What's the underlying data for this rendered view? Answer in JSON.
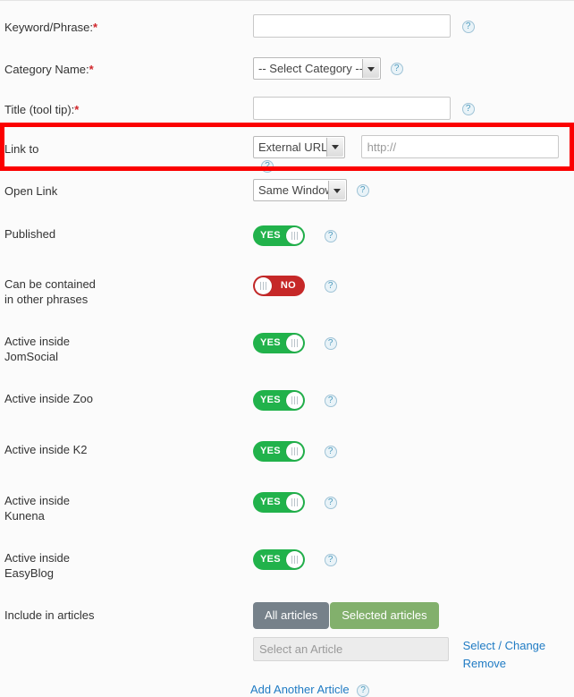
{
  "form": {
    "fields": [
      {
        "key": "keyword",
        "label": "Keyword/Phrase:",
        "required": true,
        "type": "text",
        "value": "",
        "placeholder": "",
        "help": "?"
      },
      {
        "key": "category",
        "label": "Category Name:",
        "required": true,
        "type": "select",
        "value": "-- Select Category --",
        "options": [
          "-- Select Category --"
        ],
        "help": "?"
      },
      {
        "key": "title",
        "label": "Title (tool tip):",
        "required": true,
        "type": "text",
        "value": "",
        "placeholder": "",
        "help": "?"
      },
      {
        "key": "link_to",
        "label": "Link to",
        "required": false,
        "type": "select-plus-text",
        "value": "External URL",
        "options": [
          "External URL"
        ],
        "text_value": "",
        "text_placeholder": "http://",
        "help": "?",
        "highlighted": true
      },
      {
        "key": "open_link",
        "label": "Open Link",
        "required": false,
        "type": "select",
        "value": "Same Window",
        "options": [
          "Same Window"
        ],
        "help": "?"
      },
      {
        "key": "published",
        "label": "Published",
        "required": false,
        "type": "toggle",
        "state": "YES",
        "help": "?"
      },
      {
        "key": "can_be_contained",
        "label": "Can be contained\nin other phrases",
        "required": false,
        "type": "toggle",
        "state": "NO",
        "help": "?"
      },
      {
        "key": "active_jomsocial",
        "label": "Active inside\nJomSocial",
        "required": false,
        "type": "toggle",
        "state": "YES",
        "help": "?"
      },
      {
        "key": "active_zoo",
        "label": "Active inside Zoo",
        "required": false,
        "type": "toggle",
        "state": "YES",
        "help": "?"
      },
      {
        "key": "active_k2",
        "label": "Active inside K2",
        "required": false,
        "type": "toggle",
        "state": "YES",
        "help": "?"
      },
      {
        "key": "active_kunena",
        "label": "Active inside\nKunena",
        "required": false,
        "type": "toggle",
        "state": "YES",
        "help": "?"
      },
      {
        "key": "active_easyblog",
        "label": "Active inside\nEasyBlog",
        "required": false,
        "type": "toggle",
        "state": "YES",
        "help": "?"
      }
    ],
    "include_in_articles": {
      "label": "Include in articles",
      "all_articles_button": "All articles",
      "selected_articles_button": "Selected articles",
      "article_field_placeholder": "Select an Article",
      "article_field_value": "",
      "select_change_link": "Select / Change",
      "remove_link": "Remove",
      "add_another_link": "Add Another Article",
      "add_another_help": "?"
    }
  },
  "colors": {
    "toggle_on": "#21b24b",
    "toggle_off": "#c62828",
    "button_grey": "#76818a",
    "button_green": "#82b06c",
    "link_blue": "#1f7bc4",
    "required_asterisk": "#d0252a",
    "highlight_border": "#fb0000",
    "page_background": "#fbfbfb"
  }
}
